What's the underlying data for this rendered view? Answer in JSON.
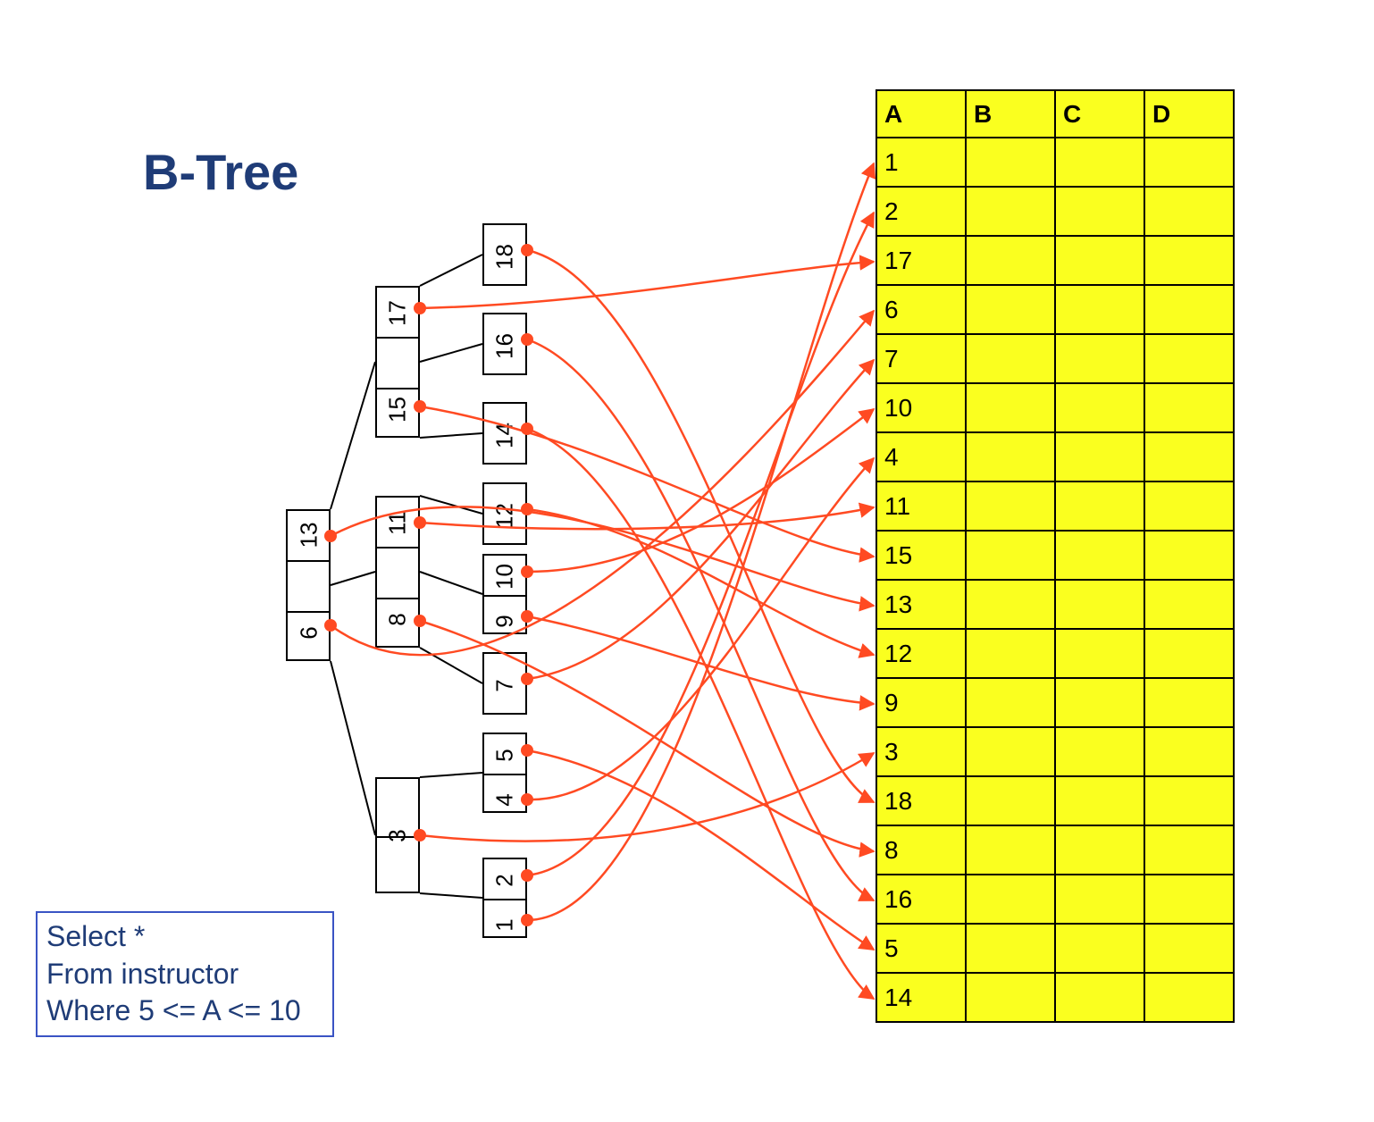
{
  "title": "B-Tree",
  "query": {
    "line1": "Select *",
    "line2": "From instructor",
    "line3": "Where 5 <= A <= 10"
  },
  "table": {
    "headers": [
      "A",
      "B",
      "C",
      "D"
    ],
    "rows": [
      "1",
      "2",
      "17",
      "6",
      "7",
      "10",
      "4",
      "11",
      "15",
      "13",
      "12",
      "9",
      "3",
      "18",
      "8",
      "16",
      "5",
      "14"
    ]
  },
  "tree": {
    "root": {
      "keys": [
        "6",
        "13"
      ]
    },
    "level2": [
      {
        "keys": [
          "3"
        ]
      },
      {
        "keys": [
          "8",
          "11"
        ]
      },
      {
        "keys": [
          "15",
          "17"
        ]
      }
    ],
    "leaves": [
      {
        "keys": [
          "1",
          "2"
        ]
      },
      {
        "keys": [
          "4",
          "5"
        ]
      },
      {
        "keys": [
          "7"
        ]
      },
      {
        "keys": [
          "9",
          "10"
        ]
      },
      {
        "keys": [
          "12"
        ]
      },
      {
        "keys": [
          "14"
        ]
      },
      {
        "keys": [
          "16"
        ]
      },
      {
        "keys": [
          "18"
        ]
      }
    ]
  },
  "colors": {
    "pointer": "#ff4a22",
    "treeEdge": "#000000",
    "tableFill": "#faff1f",
    "titleColor": "#1f3c77"
  }
}
